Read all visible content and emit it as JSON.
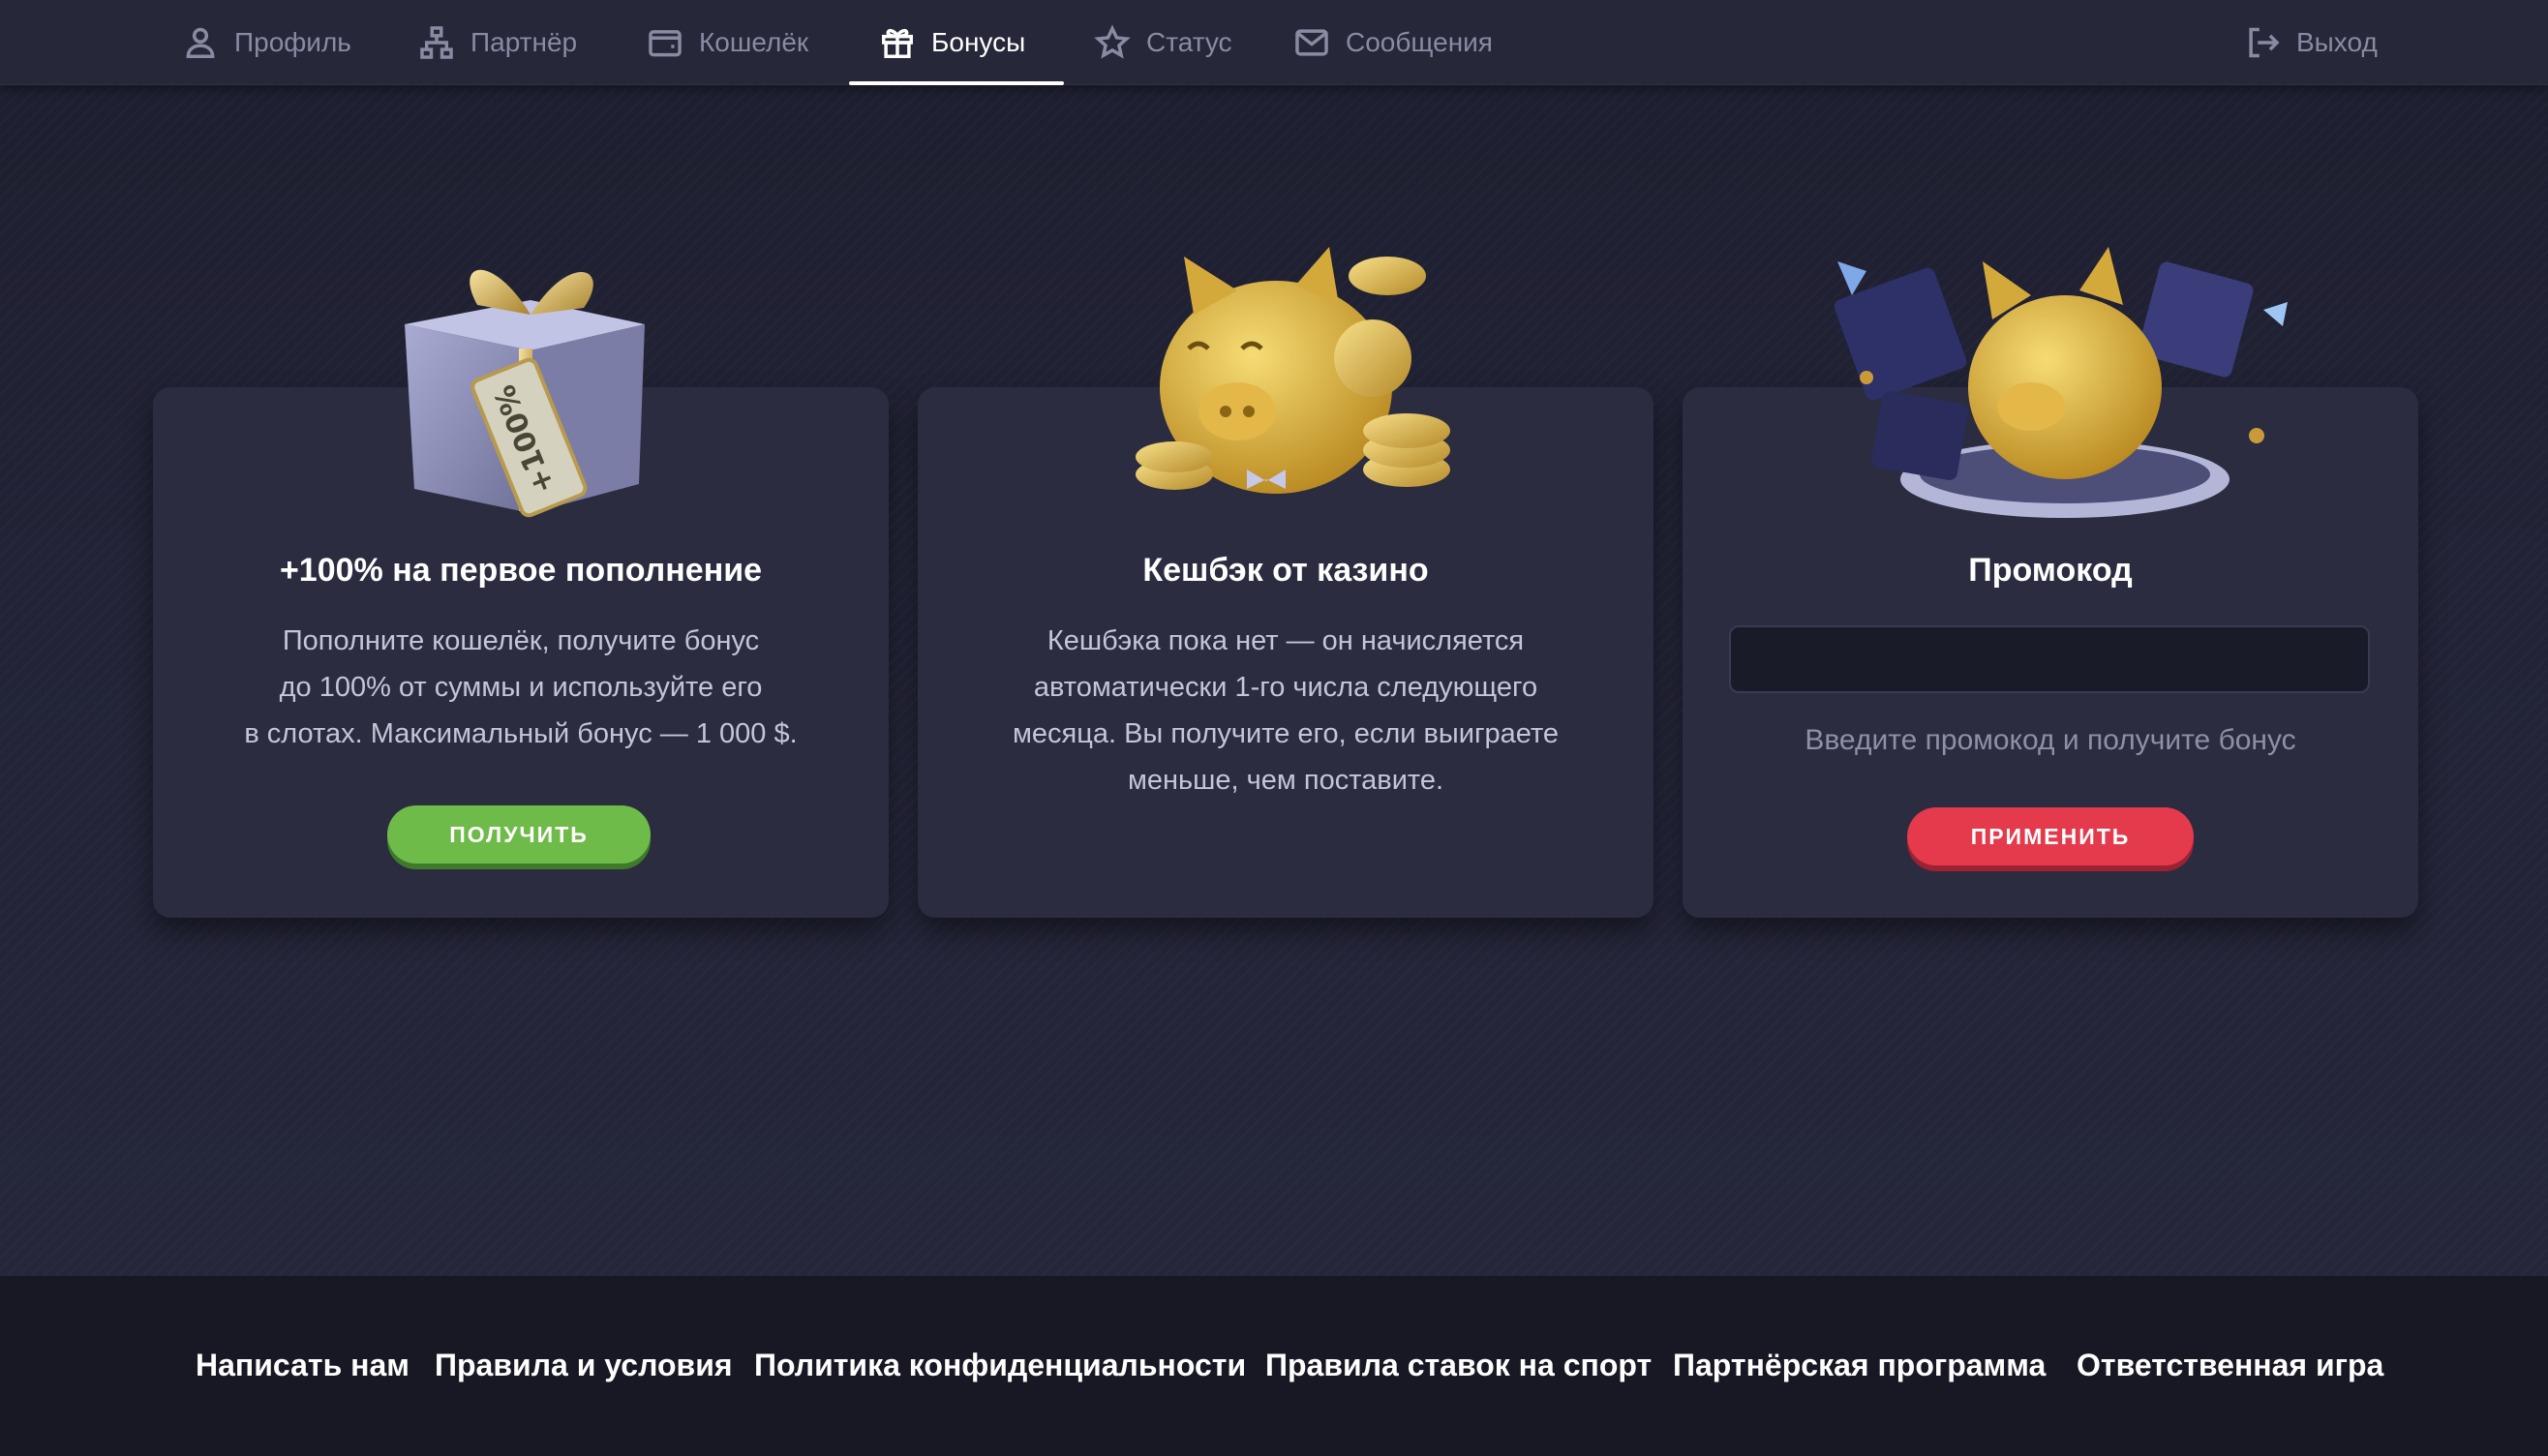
{
  "nav": {
    "items": [
      {
        "label": "Профиль",
        "icon": "user-icon"
      },
      {
        "label": "Партнёр",
        "icon": "network-icon"
      },
      {
        "label": "Кошелёк",
        "icon": "wallet-icon"
      },
      {
        "label": "Бонусы",
        "icon": "gift-icon",
        "active": true
      },
      {
        "label": "Статус",
        "icon": "star-icon"
      },
      {
        "label": "Сообщения",
        "icon": "mail-icon"
      }
    ],
    "logout": {
      "label": "Выход",
      "icon": "logout-icon"
    }
  },
  "cards": {
    "deposit": {
      "title": "+100% на первое пополнение",
      "text_lines": [
        "Пополните кошелёк, получите бонус",
        "до 100% от суммы и используйте его",
        "в слотах. Максимальный бонус — 1 000 $."
      ],
      "button": "ПОЛУЧИТЬ",
      "tag": "+100%"
    },
    "cashback": {
      "title": "Кешбэк от казино",
      "text_lines": [
        "Кешбэка пока нет — он начисляется",
        "автоматически 1-го числа следующего",
        "месяца. Вы получите его, если выиграете",
        "меньше, чем поставите."
      ]
    },
    "promo": {
      "title": "Промокод",
      "input_value": "",
      "hint": "Введите промокод и получите бонус",
      "button": "ПРИМЕНИТЬ"
    }
  },
  "footer": {
    "links": [
      "Написать нам",
      "Правила и условия",
      "Политика конфиденциальности",
      "Правила ставок на спорт",
      "Партнёрская программа",
      "Ответственная игра"
    ]
  },
  "colors": {
    "accent_green": "#6fbb49",
    "accent_red": "#e43a4c",
    "card_bg": "#2b2c40",
    "nav_bg": "#262738"
  }
}
